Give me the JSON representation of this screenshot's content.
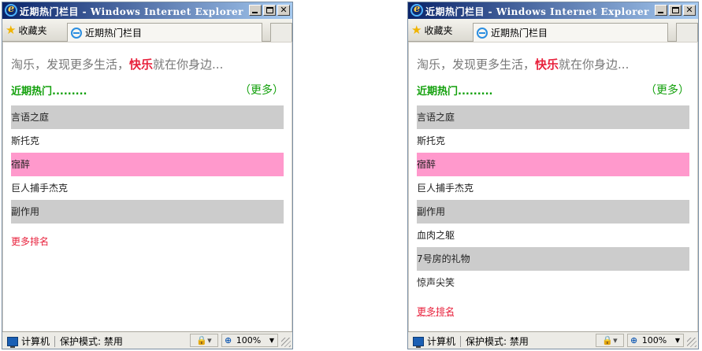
{
  "window_title": "近期热门栏目 - Windows Internet Explorer",
  "favorites_label": "收藏夹",
  "tab_title": "近期热门栏目",
  "tagline": {
    "prefix": "淘乐，发现更多生活，",
    "highlight": "快乐",
    "suffix": "就在你身边..."
  },
  "heading": "近期热门.........",
  "more_label": "（更多）",
  "rank_link": "更多排名",
  "status": {
    "zone": "计算机",
    "protected_mode": "保护模式: 禁用",
    "zoom": "100%"
  },
  "colors": {
    "gray_row": "#cccccc",
    "pink_row": "#ff99cc",
    "accent_green": "#12a00b",
    "accent_red": "#e8213c"
  },
  "windows": [
    {
      "items": [
        {
          "label": "言语之庭",
          "style": "gray"
        },
        {
          "label": "斯托克",
          "style": "white"
        },
        {
          "label": "宿醉",
          "style": "pink"
        },
        {
          "label": "巨人捕手杰克",
          "style": "white"
        },
        {
          "label": "副作用",
          "style": "gray"
        }
      ]
    },
    {
      "items": [
        {
          "label": "言语之庭",
          "style": "gray"
        },
        {
          "label": "斯托克",
          "style": "white"
        },
        {
          "label": "宿醉",
          "style": "pink"
        },
        {
          "label": "巨人捕手杰克",
          "style": "white"
        },
        {
          "label": "副作用",
          "style": "gray"
        },
        {
          "label": "血肉之躯",
          "style": "white"
        },
        {
          "label": "7号房的礼物",
          "style": "gray"
        },
        {
          "label": "惊声尖笑",
          "style": "white"
        }
      ]
    }
  ]
}
